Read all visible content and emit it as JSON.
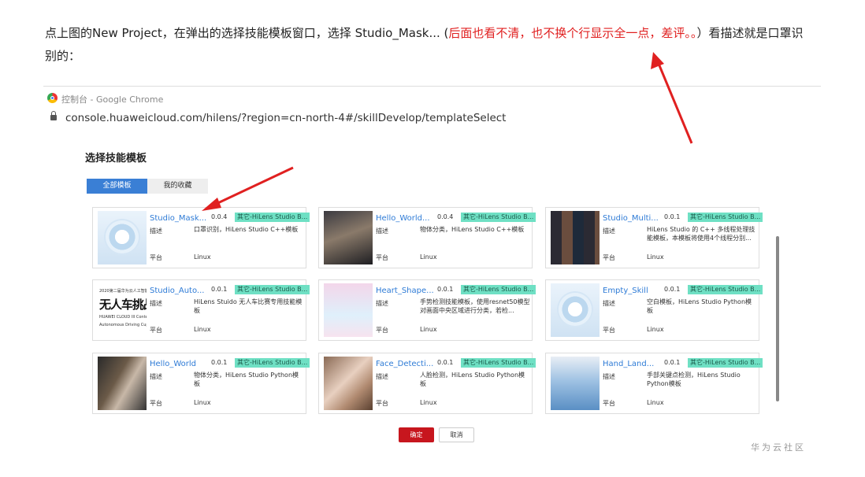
{
  "intro": {
    "text_before": "点上图的New Project，在弹出的选择技能模板窗口，选择 Studio_Mask... (",
    "text_red": "后面也看不清，也不换个行显示全一点，差评。。",
    "text_after": "）看描述就是口罩识别的："
  },
  "browser": {
    "window_title": "控制台 - Google Chrome",
    "url": "console.huaweicloud.com/hilens/?region=cn-north-4#/skillDevelop/templateSelect"
  },
  "dialog": {
    "title": "选择技能模板",
    "tabs": [
      {
        "label": "全部模板"
      },
      {
        "label": "我的收藏"
      }
    ],
    "desc_label": "描述",
    "platform_label": "平台",
    "cards": [
      {
        "name": "Studio_Mask...",
        "version": "0.0.4",
        "tag": "其它-HiLens Studio B...",
        "desc": "口罩识别，HiLens Studio C++模板",
        "platform": "Linux"
      },
      {
        "name": "Hello_World...",
        "version": "0.0.4",
        "tag": "其它-HiLens Studio B...",
        "desc": "物体分类，HiLens Studio C++模板",
        "platform": "Linux"
      },
      {
        "name": "Studio_Multi...",
        "version": "0.0.1",
        "tag": "其它-HiLens Studio B...",
        "desc": "HiLens Studio 的 C++ 多线程处理技能模板，本模板将使用4个线程分别...",
        "platform": "Linux"
      },
      {
        "name": "Studio_Auto...",
        "version": "0.0.1",
        "tag": "其它-HiLens Studio B...",
        "desc": "HiLens Stuido 无人车比赛专用技能模板",
        "platform": "Linux"
      },
      {
        "name": "Heart_Shape...",
        "version": "0.0.1",
        "tag": "其它-HiLens Studio B...",
        "desc": "手势检测技能模板，使用resnet50模型对画面中央区域进行分类，若检...",
        "platform": "Linux"
      },
      {
        "name": "Empty_Skill",
        "version": "0.0.1",
        "tag": "其它-HiLens Studio B...",
        "desc": "空白模板，HiLens Studio Python模板",
        "platform": "Linux"
      },
      {
        "name": "Hello_World",
        "version": "0.0.1",
        "tag": "其它-HiLens Studio B...",
        "desc": "物体分类，HiLens Studio Python模板",
        "platform": "Linux"
      },
      {
        "name": "Face_Detecti...",
        "version": "0.0.1",
        "tag": "其它-HiLens Studio B...",
        "desc": "人脸检测，HiLens Studio Python模板",
        "platform": "Linux"
      },
      {
        "name": "Hand_Land...",
        "version": "0.0.1",
        "tag": "其它-HiLens Studio B...",
        "desc": "手部关键点检测，HiLens Studio Python模板",
        "platform": "Linux"
      }
    ],
    "poster": {
      "line1": "2020第二届华为云人工智能大赛",
      "line2": "无人车挑战杯",
      "line3": "HUAWEI CLOUD III Contest 2020",
      "line4": "Autonomous Driving Cup"
    },
    "ok_label": "确定",
    "cancel_label": "取消"
  },
  "watermark": "华为云社区",
  "colors": {
    "accent": "#3a7fd5",
    "link": "#2e7bd6",
    "tag": "#6fe0c4",
    "ok": "#c7161e",
    "annotation": "#e02020"
  }
}
